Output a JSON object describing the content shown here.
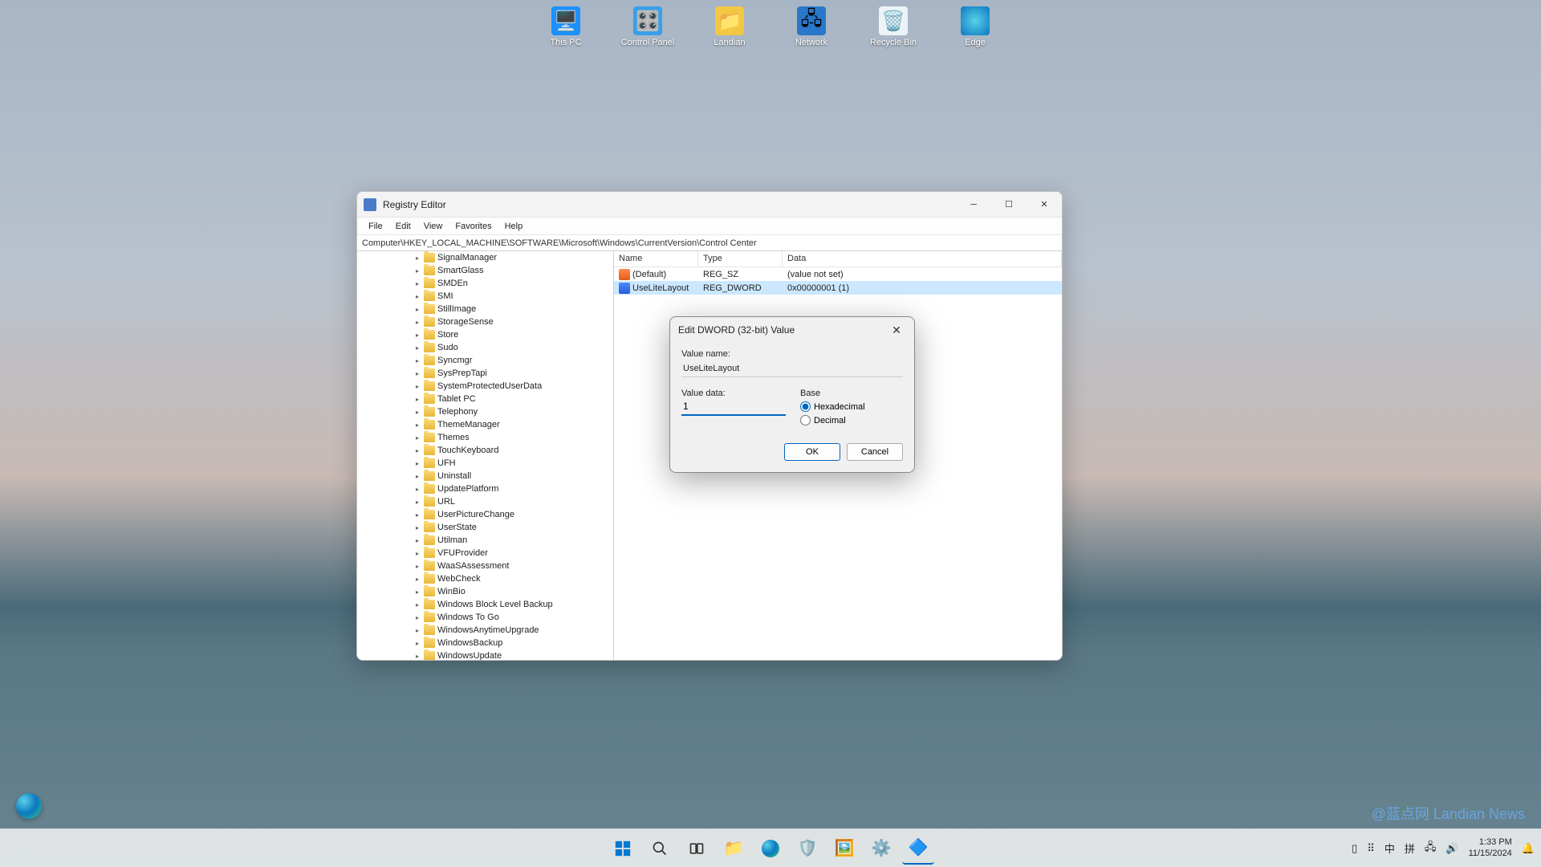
{
  "desktop": {
    "icons": [
      "This PC",
      "Control Panel",
      "Landian",
      "Network",
      "Recycle Bin",
      "Edge"
    ]
  },
  "regedit": {
    "title": "Registry Editor",
    "menus": [
      "File",
      "Edit",
      "View",
      "Favorites",
      "Help"
    ],
    "address": "Computer\\HKEY_LOCAL_MACHINE\\SOFTWARE\\Microsoft\\Windows\\CurrentVersion\\Control Center",
    "tree": [
      "SignalManager",
      "SmartGlass",
      "SMDEn",
      "SMI",
      "StillImage",
      "StorageSense",
      "Store",
      "Sudo",
      "Syncmgr",
      "SysPrepTapi",
      "SystemProtectedUserData",
      "Tablet PC",
      "Telephony",
      "ThemeManager",
      "Themes",
      "TouchKeyboard",
      "UFH",
      "Uninstall",
      "UpdatePlatform",
      "URL",
      "UserPictureChange",
      "UserState",
      "Utilman",
      "VFUProvider",
      "WaaSAssessment",
      "WebCheck",
      "WinBio",
      "Windows Block Level Backup",
      "Windows To Go",
      "WindowsAnytimeUpgrade",
      "WindowsBackup",
      "WindowsUpdate"
    ],
    "list": {
      "headers": {
        "name": "Name",
        "type": "Type",
        "data": "Data"
      },
      "rows": [
        {
          "icon": "sz",
          "name": "(Default)",
          "type": "REG_SZ",
          "data": "(value not set)"
        },
        {
          "icon": "dw",
          "name": "UseLiteLayout",
          "type": "REG_DWORD",
          "data": "0x00000001 (1)",
          "sel": true
        }
      ]
    }
  },
  "dialog": {
    "title": "Edit DWORD (32-bit) Value",
    "value_name_label": "Value name:",
    "value_name": "UseLiteLayout",
    "value_data_label": "Value data:",
    "value_data": "1",
    "base_label": "Base",
    "hex_label": "Hexadecimal",
    "dec_label": "Decimal",
    "ok": "OK",
    "cancel": "Cancel"
  },
  "taskbar": {
    "systray": {
      "ime1": "中",
      "ime2": "拼"
    },
    "time": "1:33 PM",
    "date": "11/15/2024"
  },
  "watermark": "@蓝点网 Landian News"
}
